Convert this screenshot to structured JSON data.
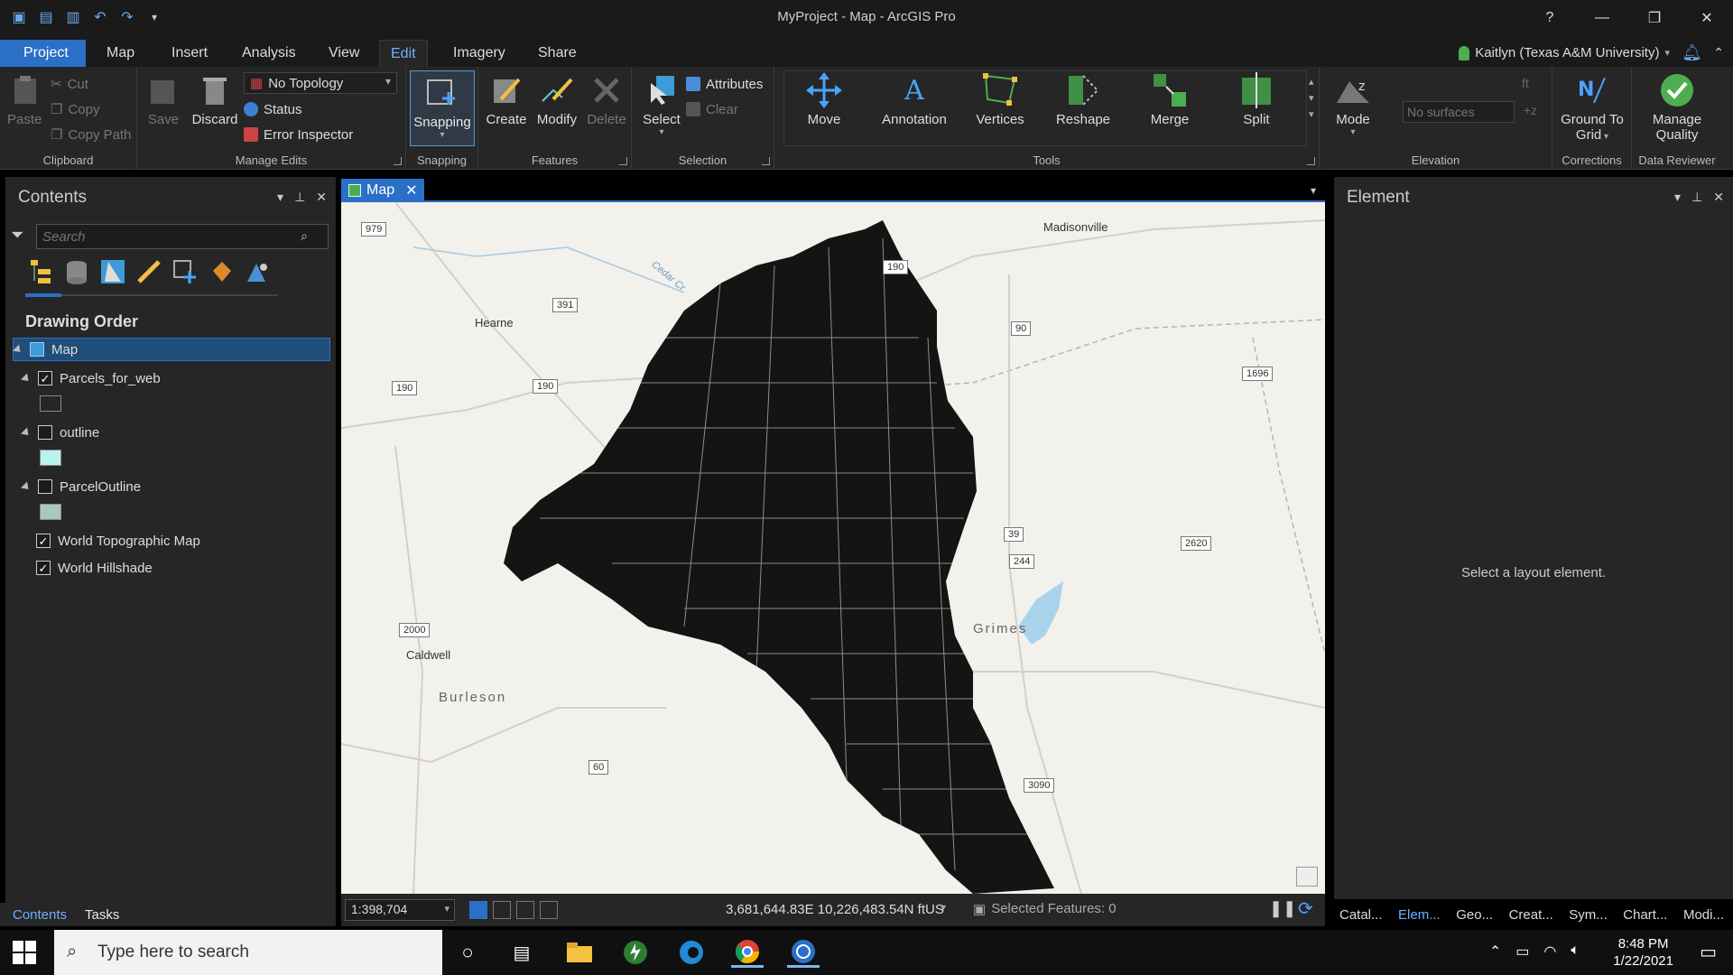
{
  "window": {
    "title": "MyProject - Map - ArcGIS Pro"
  },
  "tabs": [
    {
      "label": "Project"
    },
    {
      "label": "Map"
    },
    {
      "label": "Insert"
    },
    {
      "label": "Analysis"
    },
    {
      "label": "View"
    },
    {
      "label": "Edit"
    },
    {
      "label": "Imagery"
    },
    {
      "label": "Share"
    }
  ],
  "user": {
    "name": "Kaitlyn (Texas A&M University)"
  },
  "ribbon": {
    "clipboard": {
      "label": "Clipboard",
      "paste": "Paste",
      "cut": "Cut",
      "copy": "Copy",
      "copy_path": "Copy Path"
    },
    "manage_edits": {
      "label": "Manage Edits",
      "save": "Save",
      "discard": "Discard",
      "topology": "No Topology",
      "status": "Status",
      "error_inspector": "Error Inspector"
    },
    "snapping": {
      "label": "Snapping",
      "button": "Snapping"
    },
    "features": {
      "label": "Features",
      "create": "Create",
      "modify": "Modify",
      "delete": "Delete"
    },
    "selection": {
      "label": "Selection",
      "select": "Select",
      "attributes": "Attributes",
      "clear": "Clear"
    },
    "tools": {
      "label": "Tools",
      "move": "Move",
      "annotation": "Annotation",
      "vertices": "Vertices",
      "reshape": "Reshape",
      "merge": "Merge",
      "split": "Split"
    },
    "elevation": {
      "label": "Elevation",
      "mode": "Mode",
      "surfaces_placeholder": "No surfaces",
      "unit": "ft"
    },
    "corrections": {
      "label": "Corrections",
      "ground_to_grid": "Ground To Grid"
    },
    "data_reviewer": {
      "label": "Data Reviewer",
      "manage_quality": "Manage Quality"
    }
  },
  "contents": {
    "title": "Contents",
    "search_placeholder": "Search",
    "drawing_order": "Drawing Order",
    "map_node": "Map",
    "layers": [
      {
        "name": "Parcels_for_web",
        "checked": true,
        "swatch": "#1c1c1c"
      },
      {
        "name": "outline",
        "checked": false,
        "swatch": "#b8f3ee"
      },
      {
        "name": "ParcelOutline",
        "checked": false,
        "swatch": "#a9c9bf"
      },
      {
        "name": "World Topographic Map",
        "checked": true
      },
      {
        "name": "World Hillshade",
        "checked": true
      }
    ],
    "bottom_tabs": [
      {
        "label": "Contents"
      },
      {
        "label": "Tasks"
      }
    ]
  },
  "map": {
    "tab_label": "Map",
    "places": [
      "Madisonville",
      "Hearne",
      "Caldwell",
      "Burleson",
      "Grimes",
      "Cedar Cr"
    ],
    "shields": [
      "979",
      "190",
      "391",
      "90",
      "190",
      "190",
      "1696",
      "39",
      "2620",
      "244",
      "2000",
      "60",
      "3090"
    ],
    "scale": "1:398,704",
    "coordinates": "3,681,644.83E 10,226,483.54N ftUS",
    "selected_features": "Selected Features: 0"
  },
  "element": {
    "title": "Element",
    "message": "Select a layout element.",
    "tabs": [
      {
        "label": "Catal..."
      },
      {
        "label": "Elem..."
      },
      {
        "label": "Geo..."
      },
      {
        "label": "Creat..."
      },
      {
        "label": "Sym..."
      },
      {
        "label": "Chart..."
      },
      {
        "label": "Modi..."
      }
    ]
  },
  "taskbar": {
    "search_placeholder": "Type here to search",
    "time": "8:48 PM",
    "date": "1/22/2021"
  },
  "colors": {
    "accent": "#2b6fc7",
    "panel": "#262626",
    "chrome": "#1a1a1a",
    "map_bg": "#f2f1ec"
  }
}
